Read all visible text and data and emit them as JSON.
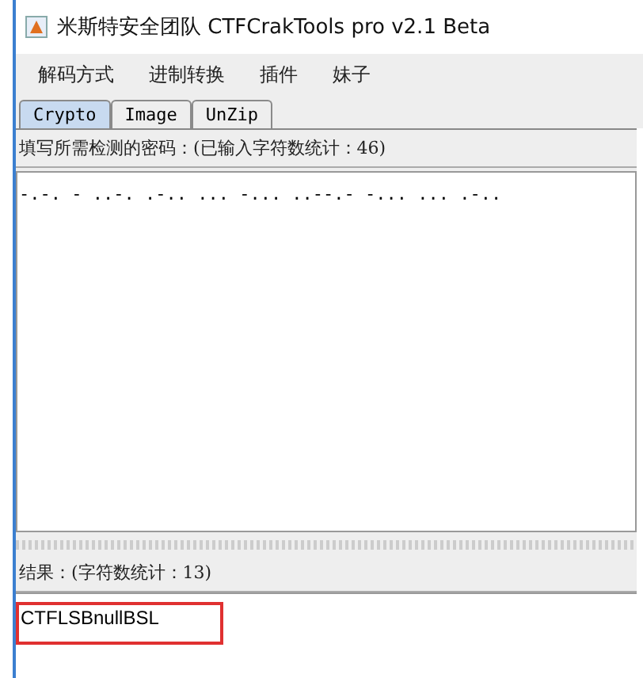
{
  "window": {
    "title": "米斯特安全团队 CTFCrakTools pro v2.1 Beta"
  },
  "menu": [
    "解码方式",
    "进制转换",
    "插件",
    "妹子"
  ],
  "tabs": [
    {
      "label": "Crypto",
      "selected": true
    },
    {
      "label": "Image",
      "selected": false
    },
    {
      "label": "UnZip",
      "selected": false
    }
  ],
  "input": {
    "label": "填写所需检测的密码：(已输入字符数统计：46)",
    "value": "-.-. - ..-. .-.. ... -... ..--.- -... ... .-.."
  },
  "result": {
    "label": "结果：(字符数统计：13)",
    "value": "CTFLSBnullBSL",
    "highlighted": true
  }
}
